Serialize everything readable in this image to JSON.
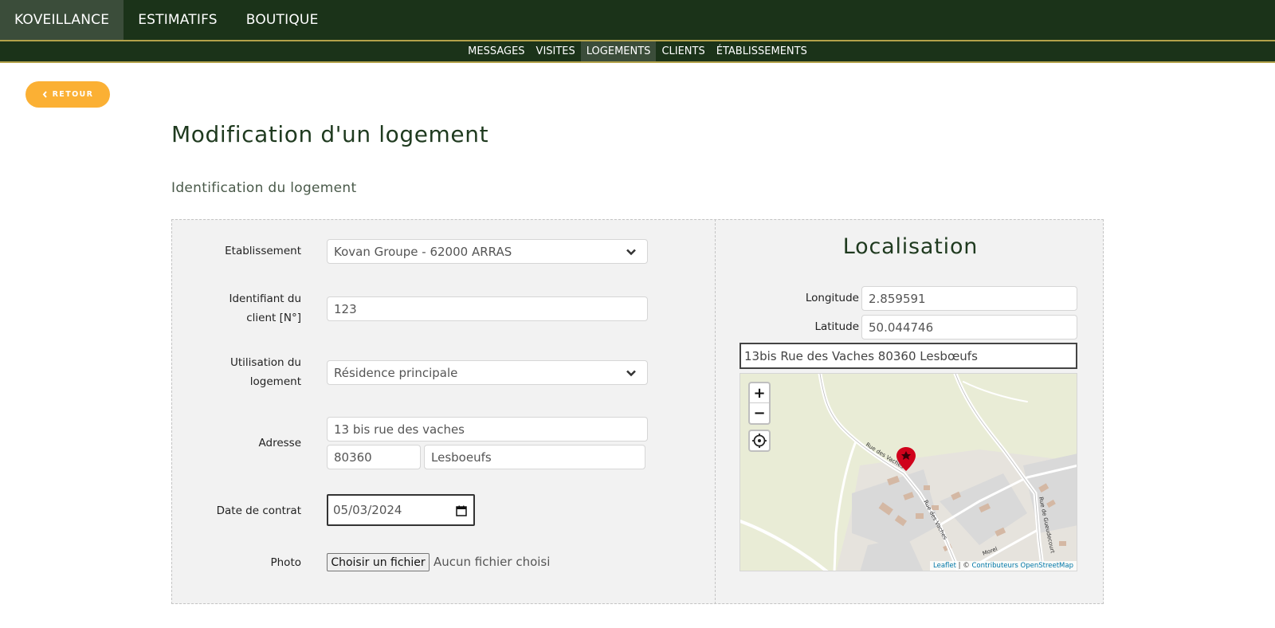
{
  "nav": {
    "items": [
      {
        "label": "KOVEILLANCE",
        "active": true
      },
      {
        "label": "ESTIMATIFS",
        "active": false
      },
      {
        "label": "BOUTIQUE",
        "active": false
      }
    ]
  },
  "subnav": {
    "items": [
      {
        "label": "MESSAGES",
        "active": false
      },
      {
        "label": "VISITES",
        "active": false
      },
      {
        "label": "LOGEMENTS",
        "active": true
      },
      {
        "label": "CLIENTS",
        "active": false
      },
      {
        "label": "ÉTABLISSEMENTS",
        "active": false
      }
    ]
  },
  "back_button": {
    "label": "RETOUR",
    "icon": "chevron-left-icon"
  },
  "page_title": "Modification d'un logement",
  "section_title": "Identification du logement",
  "form": {
    "etablissement": {
      "label": "Etablissement",
      "value": "Kovan Groupe - 62000 ARRAS"
    },
    "identifiant": {
      "label_line1": "Identifiant du",
      "label_line2": "client [N°]",
      "value": "123"
    },
    "utilisation": {
      "label_line1": "Utilisation du",
      "label_line2": "logement",
      "value": "Résidence principale"
    },
    "adresse": {
      "label": "Adresse",
      "street": "13 bis rue des vaches",
      "postcode": "80360",
      "city": "Lesboeufs"
    },
    "date_contrat": {
      "label": "Date de contrat",
      "value": "05/03/2024"
    },
    "photo": {
      "label": "Photo",
      "button_label": "Choisir un fichier",
      "status": "Aucun fichier choisi"
    }
  },
  "localisation": {
    "title": "Localisation",
    "longitude": {
      "label": "Longitude",
      "value": "2.859591"
    },
    "latitude": {
      "label": "Latitude",
      "value": "50.044746"
    },
    "address": "13bis Rue des Vaches 80360 Lesbœufs",
    "map": {
      "zoom_in": "+",
      "zoom_out": "−",
      "attribution_leaflet": "Leaflet",
      "attribution_sep": " | © ",
      "attribution_osm": "Contributeurs OpenStreetMap",
      "street_labels": [
        "Rue des Vaches",
        "Rue des Vaches",
        "Rue de Gueudecourt",
        "Morel"
      ],
      "marker_color": "#d0021b"
    }
  },
  "colors": {
    "nav_bg": "#1b3319",
    "nav_active": "#3b4d3a",
    "accent": "#fbb034",
    "title_color": "#1f3a1f"
  }
}
